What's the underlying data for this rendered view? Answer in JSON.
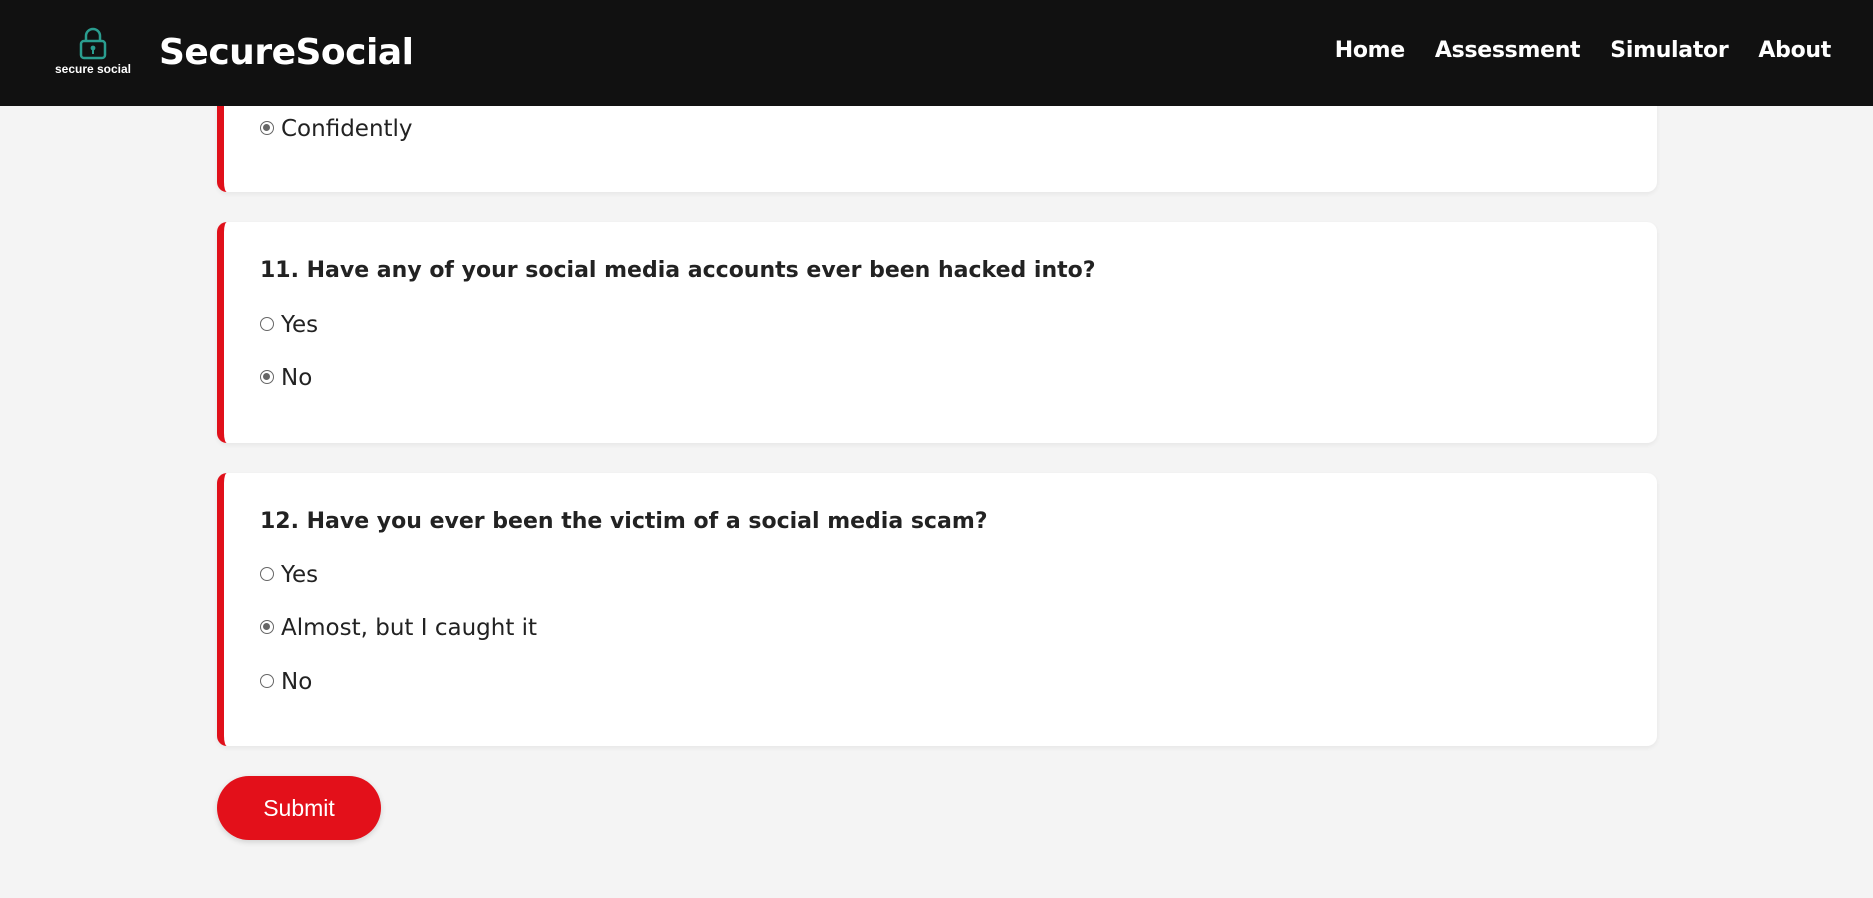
{
  "header": {
    "logo_text": "secure social",
    "brand": "SecureSocial",
    "nav": [
      {
        "label": "Home"
      },
      {
        "label": "Assessment"
      },
      {
        "label": "Simulator"
      },
      {
        "label": "About"
      }
    ]
  },
  "questions": [
    {
      "title": "",
      "options": [
        {
          "label": "Confidently",
          "checked": true
        }
      ]
    },
    {
      "title": "11. Have any of your social media accounts ever been hacked into?",
      "options": [
        {
          "label": "Yes",
          "checked": false
        },
        {
          "label": "No",
          "checked": true
        }
      ]
    },
    {
      "title": "12. Have you ever been the victim of a social media scam?",
      "options": [
        {
          "label": "Yes",
          "checked": false
        },
        {
          "label": "Almost, but I caught it",
          "checked": true
        },
        {
          "label": "No",
          "checked": false
        }
      ]
    }
  ],
  "submit_label": "Submit",
  "colors": {
    "accent": "#e3101a",
    "navbar": "#111111",
    "background": "#f4f4f4",
    "lock_icon": "#2a9d8f"
  },
  "icons": {
    "logo": "lock-icon"
  }
}
